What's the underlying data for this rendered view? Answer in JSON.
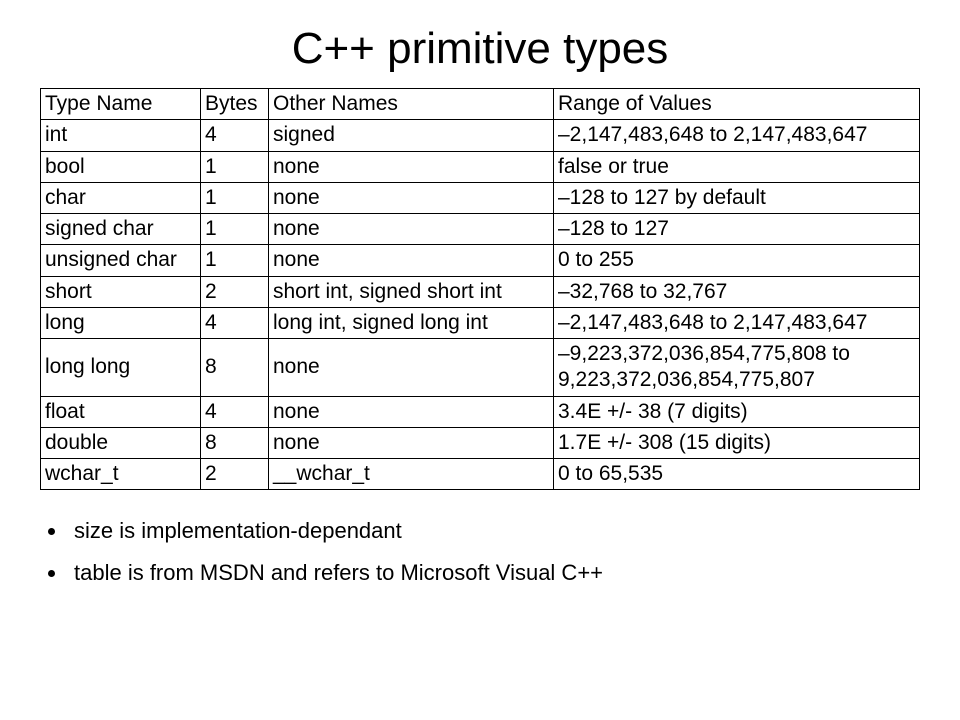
{
  "title": "C++ primitive types",
  "headers": [
    "Type Name",
    "Bytes",
    "Other Names",
    "Range of Values"
  ],
  "rows": [
    {
      "type": "int",
      "bytes": "4",
      "other": "signed",
      "range": "–2,147,483,648 to 2,147,483,647"
    },
    {
      "type": "bool",
      "bytes": "1",
      "other": "none",
      "range": "false or true"
    },
    {
      "type": "char",
      "bytes": "1",
      "other": "none",
      "range": "–128 to 127 by default"
    },
    {
      "type": "signed char",
      "bytes": "1",
      "other": "none",
      "range": "–128 to 127"
    },
    {
      "type": "unsigned char",
      "bytes": "1",
      "other": "none",
      "range": "0 to 255"
    },
    {
      "type": "short",
      "bytes": "2",
      "other": "short int, signed short int",
      "range": "–32,768 to 32,767"
    },
    {
      "type": "long",
      "bytes": "4",
      "other": "long int, signed long int",
      "range": "–2,147,483,648 to 2,147,483,647"
    },
    {
      "type": "long long",
      "bytes": "8",
      "other": "none",
      "range": "–9,223,372,036,854,775,808 to 9,223,372,036,854,775,807"
    },
    {
      "type": "float",
      "bytes": "4",
      "other": "none",
      "range": "3.4E +/- 38 (7 digits)"
    },
    {
      "type": "double",
      "bytes": "8",
      "other": "none",
      "range": "1.7E +/- 308 (15 digits)"
    },
    {
      "type": "wchar_t",
      "bytes": "2",
      "other": "__wchar_t",
      "range": "0 to 65,535"
    }
  ],
  "bullets": [
    "size is implementation-dependant",
    "table is from MSDN and refers to Microsoft Visual C++"
  ]
}
